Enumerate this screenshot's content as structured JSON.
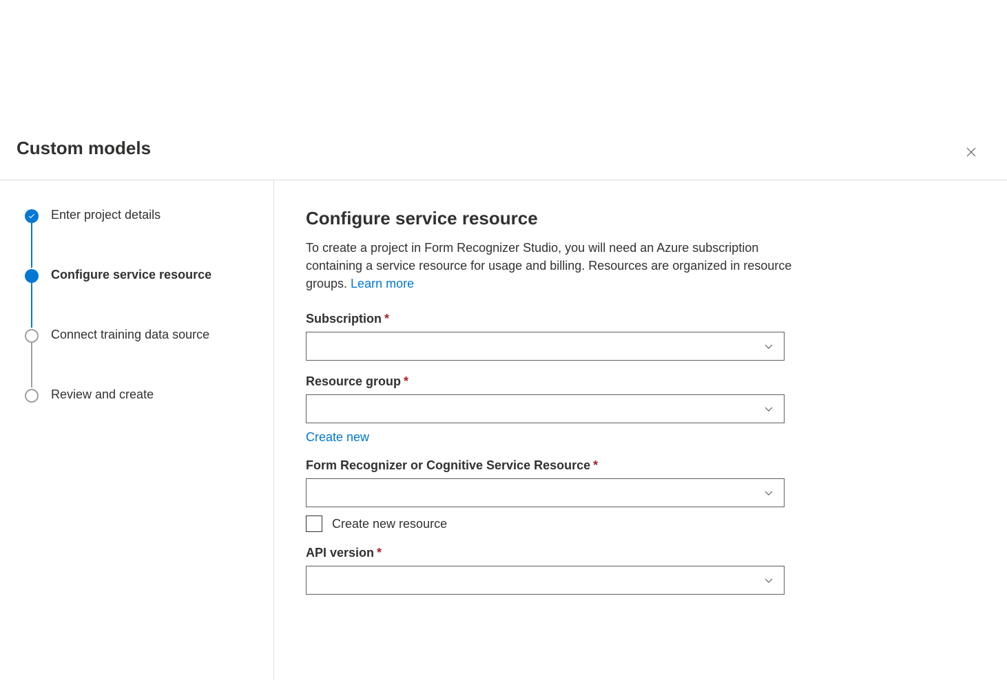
{
  "header": {
    "title": "Custom models"
  },
  "steps": [
    {
      "label": "Enter project details",
      "state": "completed"
    },
    {
      "label": "Configure service resource",
      "state": "active"
    },
    {
      "label": "Connect training data source",
      "state": "inactive"
    },
    {
      "label": "Review and create",
      "state": "inactive"
    }
  ],
  "main": {
    "title": "Configure service resource",
    "description": "To create a project in Form Recognizer Studio, you will need an Azure subscription containing a service resource for usage and billing. Resources are organized in resource groups. ",
    "learn_more_label": "Learn more"
  },
  "form": {
    "subscription": {
      "label": "Subscription",
      "value": ""
    },
    "resource_group": {
      "label": "Resource group",
      "value": "",
      "create_new_label": "Create new"
    },
    "service_resource": {
      "label": "Form Recognizer or Cognitive Service Resource",
      "value": "",
      "checkbox_label": "Create new resource",
      "checkbox_checked": false
    },
    "api_version": {
      "label": "API version",
      "value": ""
    }
  }
}
